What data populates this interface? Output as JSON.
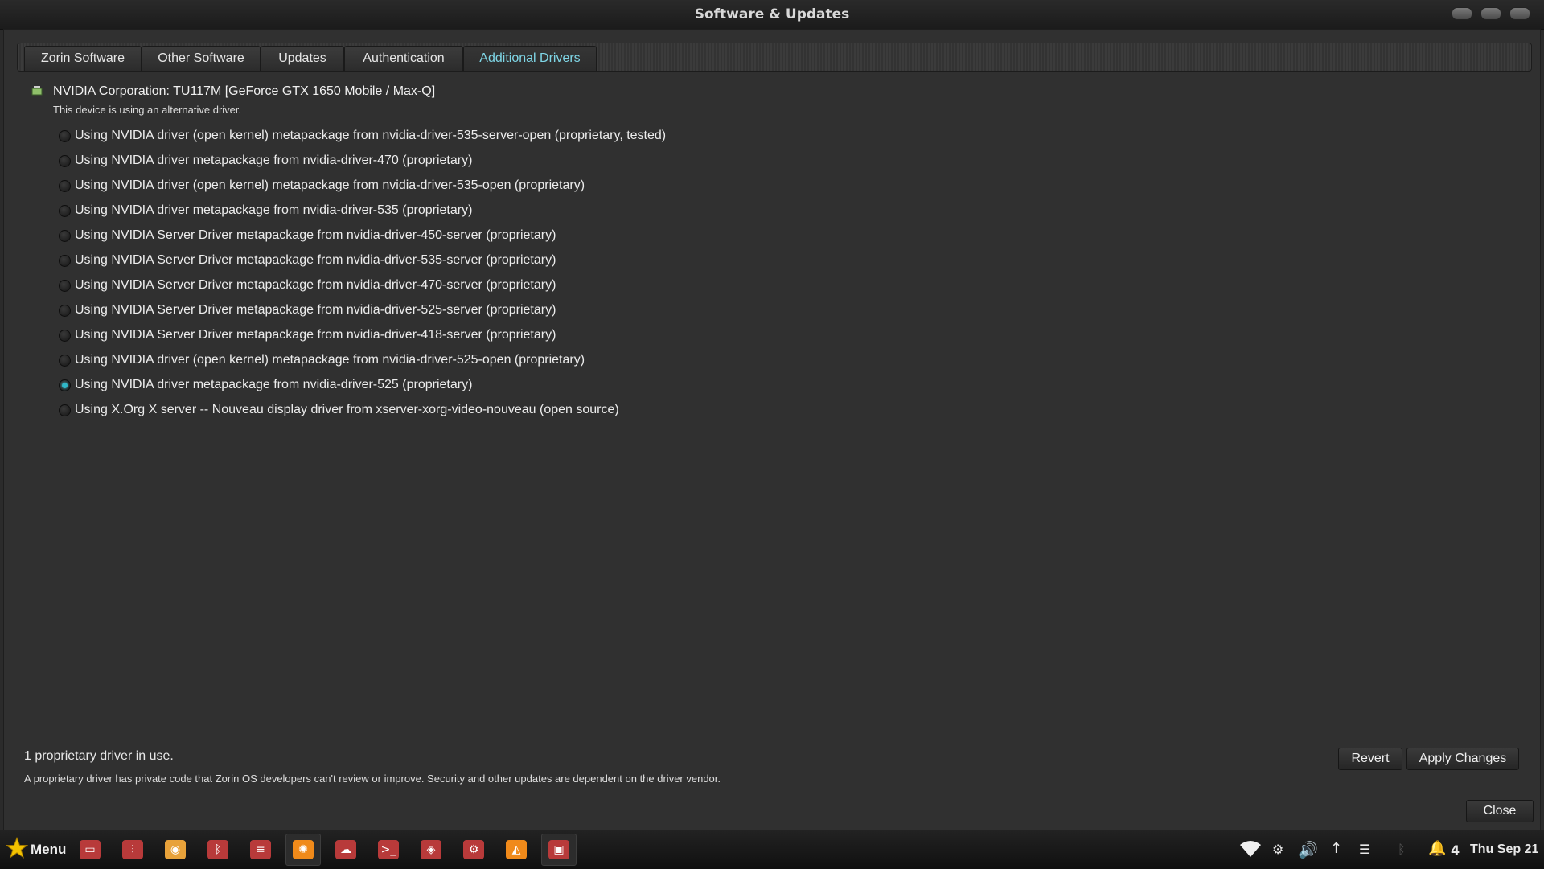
{
  "window": {
    "title": "Software & Updates",
    "tabs": [
      {
        "label": "Zorin Software",
        "active": false
      },
      {
        "label": "Other Software",
        "active": false
      },
      {
        "label": "Updates",
        "active": false
      },
      {
        "label": "Authentication",
        "active": false
      },
      {
        "label": "Additional Drivers",
        "active": true
      }
    ]
  },
  "device": {
    "name": "NVIDIA Corporation: TU117M [GeForce GTX 1650 Mobile / Max-Q]",
    "status": "This device is using an alternative driver.",
    "options": [
      {
        "label": "Using NVIDIA driver (open kernel) metapackage from nvidia-driver-535-server-open (proprietary, tested)",
        "selected": false
      },
      {
        "label": "Using NVIDIA driver metapackage from nvidia-driver-470 (proprietary)",
        "selected": false
      },
      {
        "label": "Using NVIDIA driver (open kernel) metapackage from nvidia-driver-535-open (proprietary)",
        "selected": false
      },
      {
        "label": "Using NVIDIA driver metapackage from nvidia-driver-535 (proprietary)",
        "selected": false
      },
      {
        "label": "Using NVIDIA Server Driver metapackage from nvidia-driver-450-server (proprietary)",
        "selected": false
      },
      {
        "label": "Using NVIDIA Server Driver metapackage from nvidia-driver-535-server (proprietary)",
        "selected": false
      },
      {
        "label": "Using NVIDIA Server Driver metapackage from nvidia-driver-470-server (proprietary)",
        "selected": false
      },
      {
        "label": "Using NVIDIA Server Driver metapackage from nvidia-driver-525-server (proprietary)",
        "selected": false
      },
      {
        "label": "Using NVIDIA Server Driver metapackage from nvidia-driver-418-server (proprietary)",
        "selected": false
      },
      {
        "label": "Using NVIDIA driver (open kernel) metapackage from nvidia-driver-525-open (proprietary)",
        "selected": false
      },
      {
        "label": "Using NVIDIA driver metapackage from nvidia-driver-525 (proprietary)",
        "selected": true
      },
      {
        "label": "Using X.Org X server -- Nouveau display driver from xserver-xorg-video-nouveau (open source)",
        "selected": false
      }
    ]
  },
  "footer": {
    "summary": "1 proprietary driver in use.",
    "note": "A proprietary driver has private code that Zorin OS developers can't review or improve. Security and other updates are dependent on the driver vendor.",
    "revert_label": "Revert",
    "apply_label": "Apply Changes",
    "close_label": "Close"
  },
  "taskbar": {
    "menu_label": "Menu",
    "apps": [
      {
        "icon": "system-monitor-icon",
        "color": "#b83a3a",
        "running": false
      },
      {
        "icon": "mixer-icon",
        "color": "#b83a3a",
        "running": false
      },
      {
        "icon": "pidgin-bird-icon",
        "color": "#e8a23a",
        "running": false
      },
      {
        "icon": "bluetooth-app-icon",
        "color": "#b83a3a",
        "running": false
      },
      {
        "icon": "text-editor-icon",
        "color": "#b83a3a",
        "running": false
      },
      {
        "icon": "xfburn-disc-icon",
        "color": "#f08a1a",
        "running": true
      },
      {
        "icon": "cloud-upload-icon",
        "color": "#b83a3a",
        "running": false
      },
      {
        "icon": "terminal-icon",
        "color": "#b83a3a",
        "running": false
      },
      {
        "icon": "brave-browser-icon",
        "color": "#b83a3a",
        "running": false
      },
      {
        "icon": "steam-icon",
        "color": "#b83a3a",
        "running": false
      },
      {
        "icon": "blender-icon",
        "color": "#f08a1a",
        "running": false
      },
      {
        "icon": "software-updates-icon",
        "color": "#b83a3a",
        "running": true
      }
    ],
    "notification_count": "4",
    "clock": "Thu Sep 21"
  }
}
